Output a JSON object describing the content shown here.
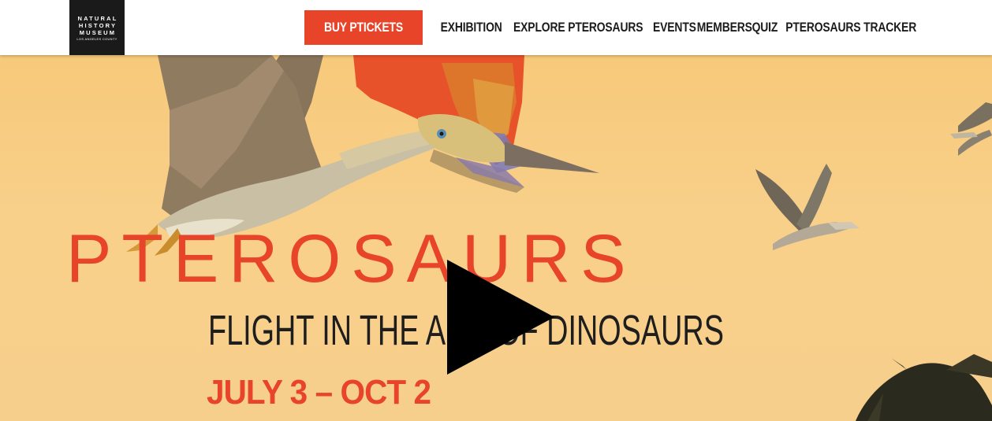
{
  "header": {
    "logo": {
      "lines": [
        "NATURAL",
        "HISTORY",
        "MUSEUM"
      ],
      "subline": "LOS ANGELES COUNTY"
    },
    "cta_label": "BUY PTICKETS",
    "nav": [
      {
        "label": "EXHIBITION"
      },
      {
        "label": "EXPLORE PTEROSAURS"
      },
      {
        "label": "EVENTS"
      },
      {
        "label": "MEMBERS"
      },
      {
        "label": "QUIZ"
      },
      {
        "label": "PTEROSAURS TRACKER"
      }
    ]
  },
  "hero": {
    "title": "PTEROSAURS",
    "subtitle": "FLIGHT IN THE AGE OF DINOSAURS",
    "dates": "JULY 3 – OCT 2",
    "play_icon": "play-icon"
  },
  "colors": {
    "accent": "#e8442a",
    "hero_bg": "#f8d08a",
    "text_dark": "#1e1e1e",
    "logo_bg": "#1a1a1a"
  }
}
